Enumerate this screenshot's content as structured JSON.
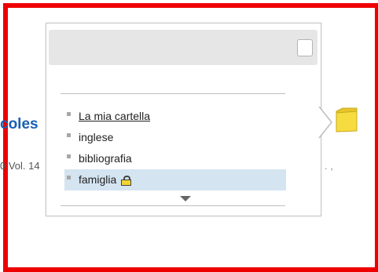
{
  "background": {
    "title_fragment": "coles",
    "meta_fragment": "0 Vol. 14",
    "meta_trailing": ". ,"
  },
  "popup": {
    "folders": [
      {
        "label": "La mia cartella",
        "state": "current"
      },
      {
        "label": "inglese",
        "state": "normal"
      },
      {
        "label": "bibliografia",
        "state": "normal"
      },
      {
        "label": "famiglia",
        "state": "selected",
        "icon": "lock-icon"
      }
    ],
    "scroll_icon": "triangle-down"
  },
  "side_icon": "folder-icon",
  "colors": {
    "frame": "#ee0000",
    "link": "#1a5fb4",
    "selected_row": "#d4e4f1",
    "header": "#e6e6e6",
    "folder": "#f6dc3e"
  }
}
